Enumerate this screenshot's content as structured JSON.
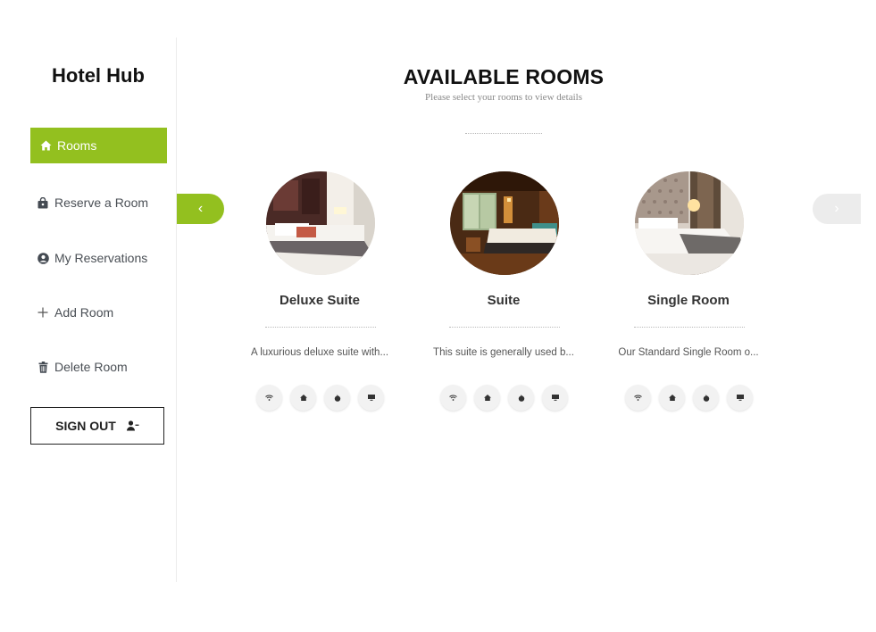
{
  "app": {
    "brand": "Hotel Hub"
  },
  "sidebar": {
    "items": [
      {
        "label": "Rooms",
        "icon": "home-icon",
        "active": true
      },
      {
        "label": "Reserve a Room",
        "icon": "shopping-bag-icon",
        "active": false
      },
      {
        "label": "My Reservations",
        "icon": "user-circle-icon",
        "active": false
      },
      {
        "label": "Add Room",
        "icon": "plus-icon",
        "active": false
      },
      {
        "label": "Delete Room",
        "icon": "trash-icon",
        "active": false
      }
    ],
    "signout_label": "SIGN OUT",
    "signout_icon": "user-minus-icon"
  },
  "main": {
    "title": "AVAILABLE ROOMS",
    "subtitle": "Please select your rooms to view details",
    "prev_arrow": "‹",
    "next_arrow": "›",
    "rooms": [
      {
        "name": "Deluxe Suite",
        "description": "A luxurious deluxe suite with..."
      },
      {
        "name": "Suite",
        "description": "This suite is generally used b..."
      },
      {
        "name": "Single Room",
        "description": "Our Standard Single Room o..."
      }
    ],
    "amenity_icons": [
      "wifi-icon",
      "home-icon",
      "fire-icon",
      "tv-icon"
    ]
  },
  "colors": {
    "accent": "#93c01f",
    "disabled_arrow": "#ececec",
    "text_dark": "#111111",
    "text_muted": "#888888"
  }
}
